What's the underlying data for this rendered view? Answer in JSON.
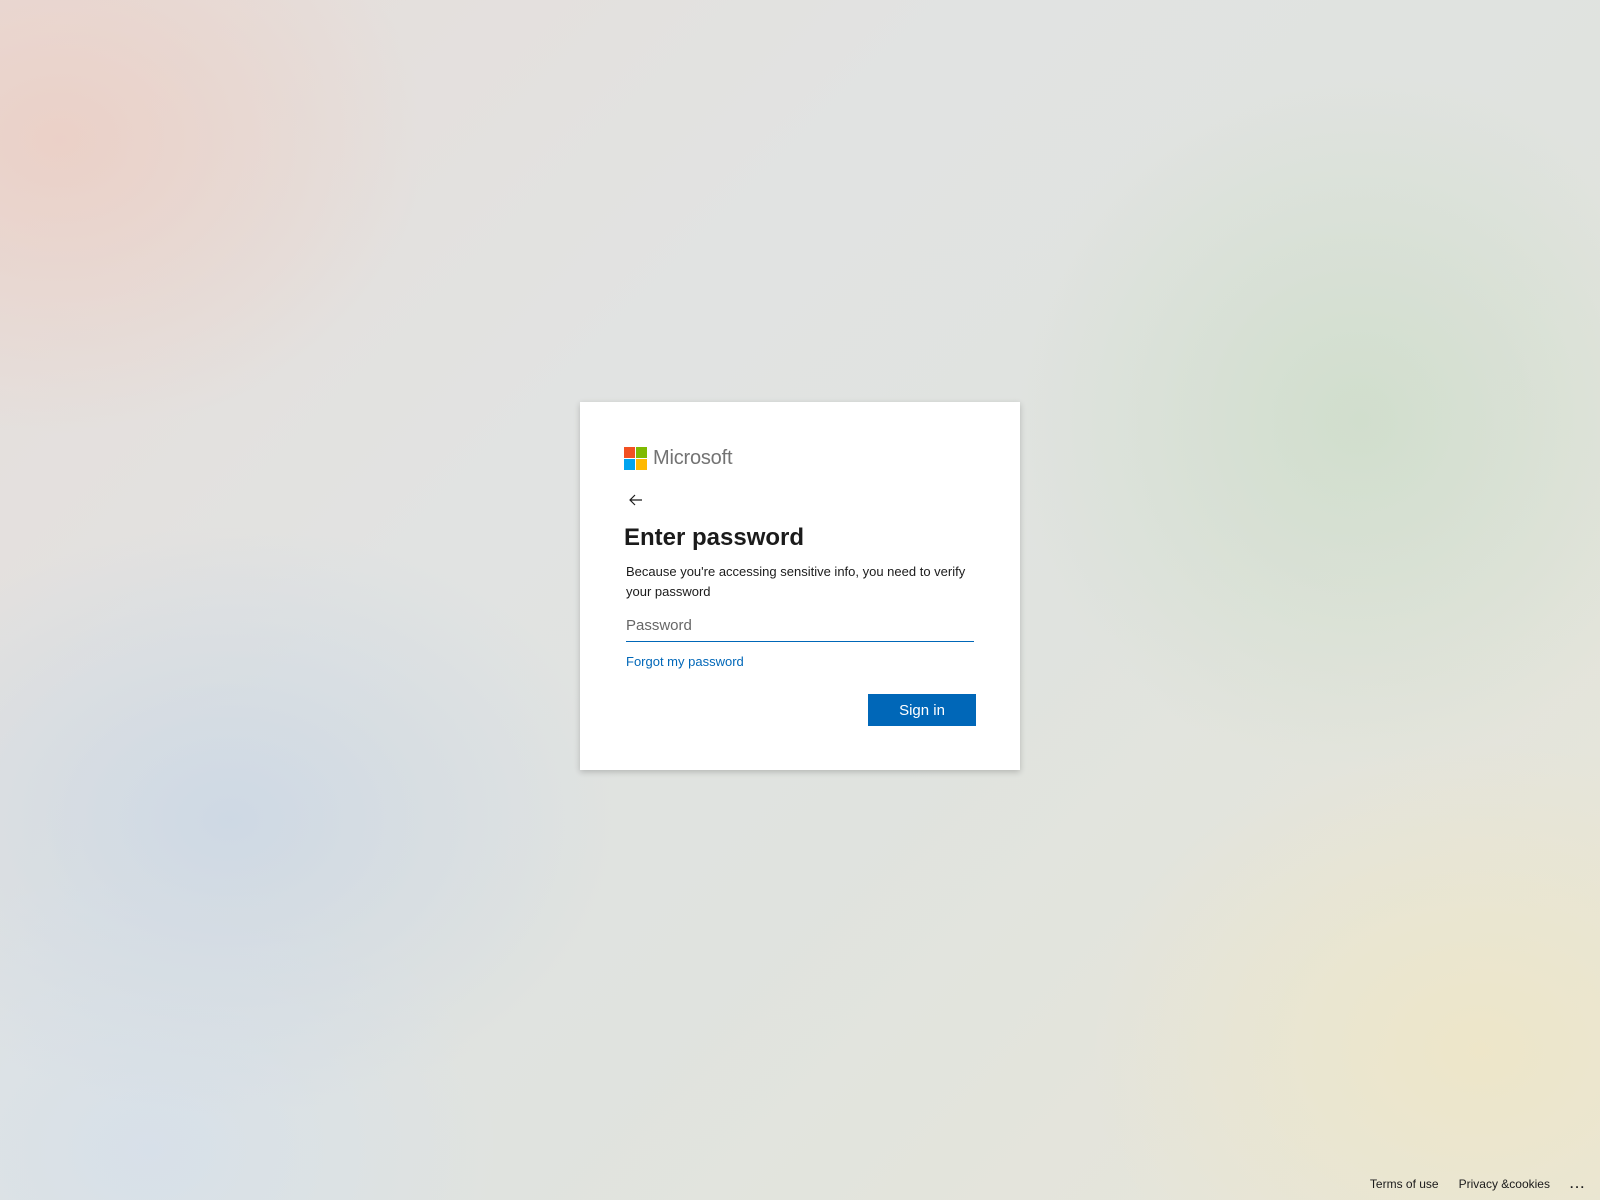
{
  "brand": {
    "name": "Microsoft",
    "logo_colors": [
      "#f25022",
      "#7fba00",
      "#00a4ef",
      "#ffb900"
    ]
  },
  "signin": {
    "back_icon": "arrow-left-icon",
    "title": "Enter password",
    "description": "Because you're accessing sensitive info, you need to verify your password",
    "password_placeholder": "Password",
    "password_value": "",
    "forgot_link": "Forgot my password",
    "signin_button": "Sign in"
  },
  "footer": {
    "terms": "Terms of use",
    "privacy": "Privacy &cookies",
    "more": "..."
  },
  "colors": {
    "accent": "#0067b8",
    "text": "#1b1b1b",
    "card_bg": "#ffffff"
  }
}
